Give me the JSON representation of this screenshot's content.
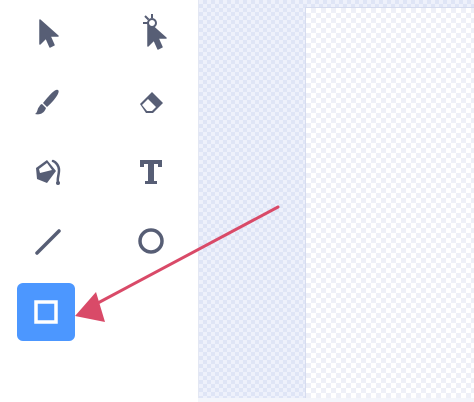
{
  "toolbar": {
    "tools": [
      {
        "name": "select",
        "icon": "arrow-pointer-icon"
      },
      {
        "name": "reshape",
        "icon": "reshape-pointer-icon"
      },
      {
        "name": "brush",
        "icon": "brush-icon"
      },
      {
        "name": "eraser",
        "icon": "eraser-icon"
      },
      {
        "name": "fill",
        "icon": "paint-bucket-icon"
      },
      {
        "name": "text",
        "icon": "text-icon",
        "glyph": "T"
      },
      {
        "name": "line",
        "icon": "line-icon"
      },
      {
        "name": "circle",
        "icon": "circle-icon"
      },
      {
        "name": "rectangle",
        "icon": "rectangle-icon",
        "selected": true
      }
    ]
  },
  "colors": {
    "icon": "#575e75",
    "selected_background": "#4c97ff",
    "annotation_arrow": "#d94a68"
  },
  "annotation": {
    "type": "arrow",
    "points_to": "rectangle"
  }
}
